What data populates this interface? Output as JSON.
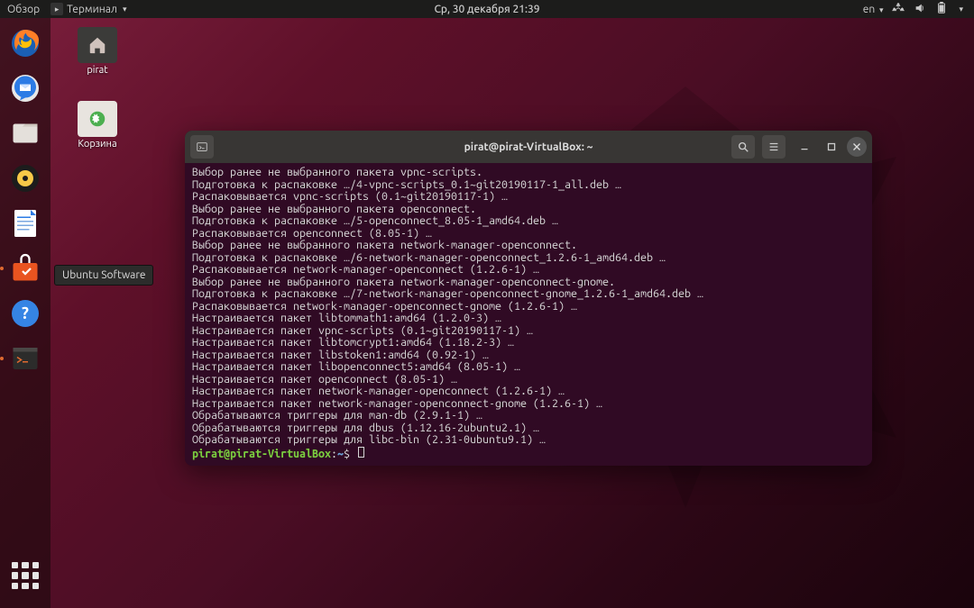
{
  "topbar": {
    "activities": "Обзор",
    "app": "Терминал",
    "datetime": "Ср, 30 декабря  21:39",
    "lang": "en"
  },
  "dock": {
    "tooltip": "Ubuntu Software"
  },
  "desktop": {
    "home_label": "pirat",
    "trash_label": "Корзина"
  },
  "terminal": {
    "title": "pirat@pirat-VirtualBox: ~",
    "lines": [
      "Выбор ранее не выбранного пакета vpnc-scripts.",
      "Подготовка к распаковке …/4-vpnc-scripts_0.1~git20190117-1_all.deb …",
      "Распаковывается vpnc-scripts (0.1~git20190117-1) …",
      "Выбор ранее не выбранного пакета openconnect.",
      "Подготовка к распаковке …/5-openconnect_8.05-1_amd64.deb …",
      "Распаковывается openconnect (8.05-1) …",
      "Выбор ранее не выбранного пакета network-manager-openconnect.",
      "Подготовка к распаковке …/6-network-manager-openconnect_1.2.6-1_amd64.deb …",
      "Распаковывается network-manager-openconnect (1.2.6-1) …",
      "Выбор ранее не выбранного пакета network-manager-openconnect-gnome.",
      "Подготовка к распаковке …/7-network-manager-openconnect-gnome_1.2.6-1_amd64.deb …",
      "Распаковывается network-manager-openconnect-gnome (1.2.6-1) …",
      "Настраивается пакет libtommath1:amd64 (1.2.0-3) …",
      "Настраивается пакет vpnc-scripts (0.1~git20190117-1) …",
      "Настраивается пакет libtomcrypt1:amd64 (1.18.2-3) …",
      "Настраивается пакет libstoken1:amd64 (0.92-1) …",
      "Настраивается пакет libopenconnect5:amd64 (8.05-1) …",
      "Настраивается пакет openconnect (8.05-1) …",
      "Настраивается пакет network-manager-openconnect (1.2.6-1) …",
      "Настраивается пакет network-manager-openconnect-gnome (1.2.6-1) …",
      "Обрабатываются триггеры для man-db (2.9.1-1) …",
      "Обрабатываются триггеры для dbus (1.12.16-2ubuntu2.1) …",
      "Обрабатываются триггеры для libc-bin (2.31-0ubuntu9.1) …"
    ],
    "prompt_user": "pirat@pirat-VirtualBox",
    "prompt_sep": ":",
    "prompt_path": "~",
    "prompt_sym": "$"
  }
}
